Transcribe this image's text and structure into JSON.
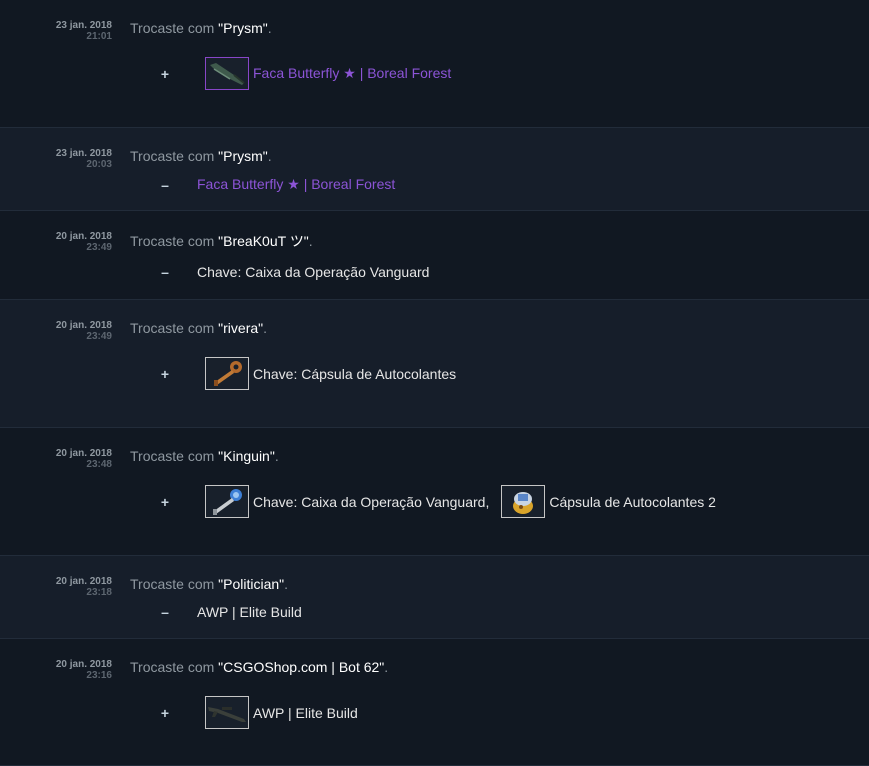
{
  "trades": [
    {
      "date": "23 jan. 2018",
      "time": "21:01",
      "prefix": "Trocaste com ",
      "partner": "\"Prysm\"",
      "suffix": ".",
      "sign": "+",
      "items": [
        {
          "name": "Faca Butterfly ★ | Boreal Forest",
          "icon": "butterfly-knife-icon",
          "color": "#8c54d6"
        }
      ]
    },
    {
      "date": "23 jan. 2018",
      "time": "20:03",
      "prefix": "Trocaste com ",
      "partner": "\"Prysm\"",
      "suffix": ".",
      "sign": "–",
      "items": [
        {
          "name": "Faca Butterfly ★ | Boreal Forest",
          "color": "#8c54d6"
        }
      ]
    },
    {
      "date": "20 jan. 2018",
      "time": "23:49",
      "prefix": "Trocaste com ",
      "partner": "\"BreaK0uT ツ\"",
      "suffix": ".",
      "sign": "–",
      "items": [
        {
          "name": "Chave: Caixa da Operação Vanguard",
          "color": "#e6e6e6"
        }
      ]
    },
    {
      "date": "20 jan. 2018",
      "time": "23:49",
      "prefix": "Trocaste com ",
      "partner": "\"rivera\"",
      "suffix": ".",
      "sign": "+",
      "items": [
        {
          "name": "Chave: Cápsula de Autocolantes",
          "icon": "bronze-key-icon",
          "color": "#e6e6e6"
        }
      ]
    },
    {
      "date": "20 jan. 2018",
      "time": "23:48",
      "prefix": "Trocaste com ",
      "partner": "\"Kinguin\"",
      "suffix": ".",
      "sign": "+",
      "items": [
        {
          "name": "Chave: Caixa da Operação Vanguard",
          "icon": "silver-key-icon",
          "color": "#e6e6e6",
          "separator": ","
        },
        {
          "name": "Cápsula de Autocolantes 2",
          "icon": "sticker-capsule-icon",
          "color": "#e6e6e6"
        }
      ]
    },
    {
      "date": "20 jan. 2018",
      "time": "23:18",
      "prefix": "Trocaste com ",
      "partner": "\"Politician\"",
      "suffix": ".",
      "sign": "–",
      "items": [
        {
          "name": "AWP | Elite Build",
          "color": "#e6e6e6"
        }
      ]
    },
    {
      "date": "20 jan. 2018",
      "time": "23:16",
      "prefix": "Trocaste com ",
      "partner": "\"CSGOShop.com | Bot 62\"",
      "suffix": ".",
      "sign": "+",
      "items": [
        {
          "name": "AWP | Elite Build",
          "icon": "awp-rifle-icon",
          "color": "#e6e6e6"
        }
      ]
    }
  ]
}
